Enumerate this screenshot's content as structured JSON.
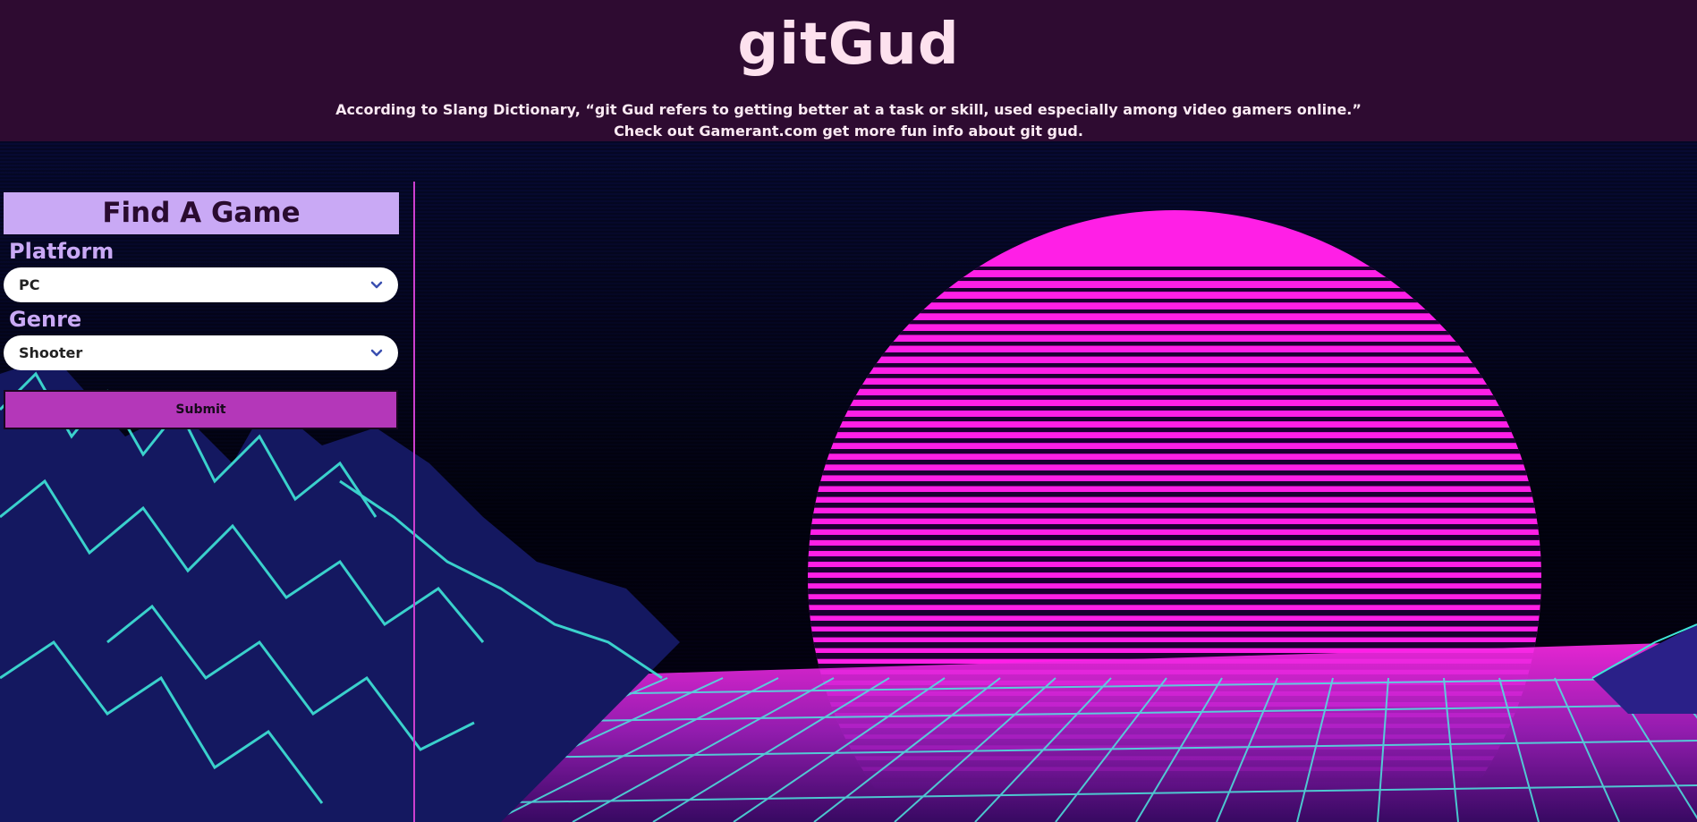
{
  "header": {
    "title": "gitGud",
    "tagline_line1": "According to Slang Dictionary, “git Gud refers to getting better at a task or skill, used especially among video gamers online.”",
    "tagline_line2": "Check out Gamerant.com get more fun info about git gud."
  },
  "finder": {
    "heading": "Find A Game",
    "platform_label": "Platform",
    "platform_value": "PC",
    "genre_label": "Genre",
    "genre_value": "Shooter",
    "submit_label": "Submit"
  },
  "colors": {
    "header_bg": "#2e0b31",
    "accent_lavender": "#c9a9f5",
    "submit_bg": "#b437b9",
    "sun_magenta": "#ff1fe6",
    "grid_cyan": "#3fe6d8"
  },
  "icons": {
    "select_chevron": "chevron-down-icon"
  }
}
